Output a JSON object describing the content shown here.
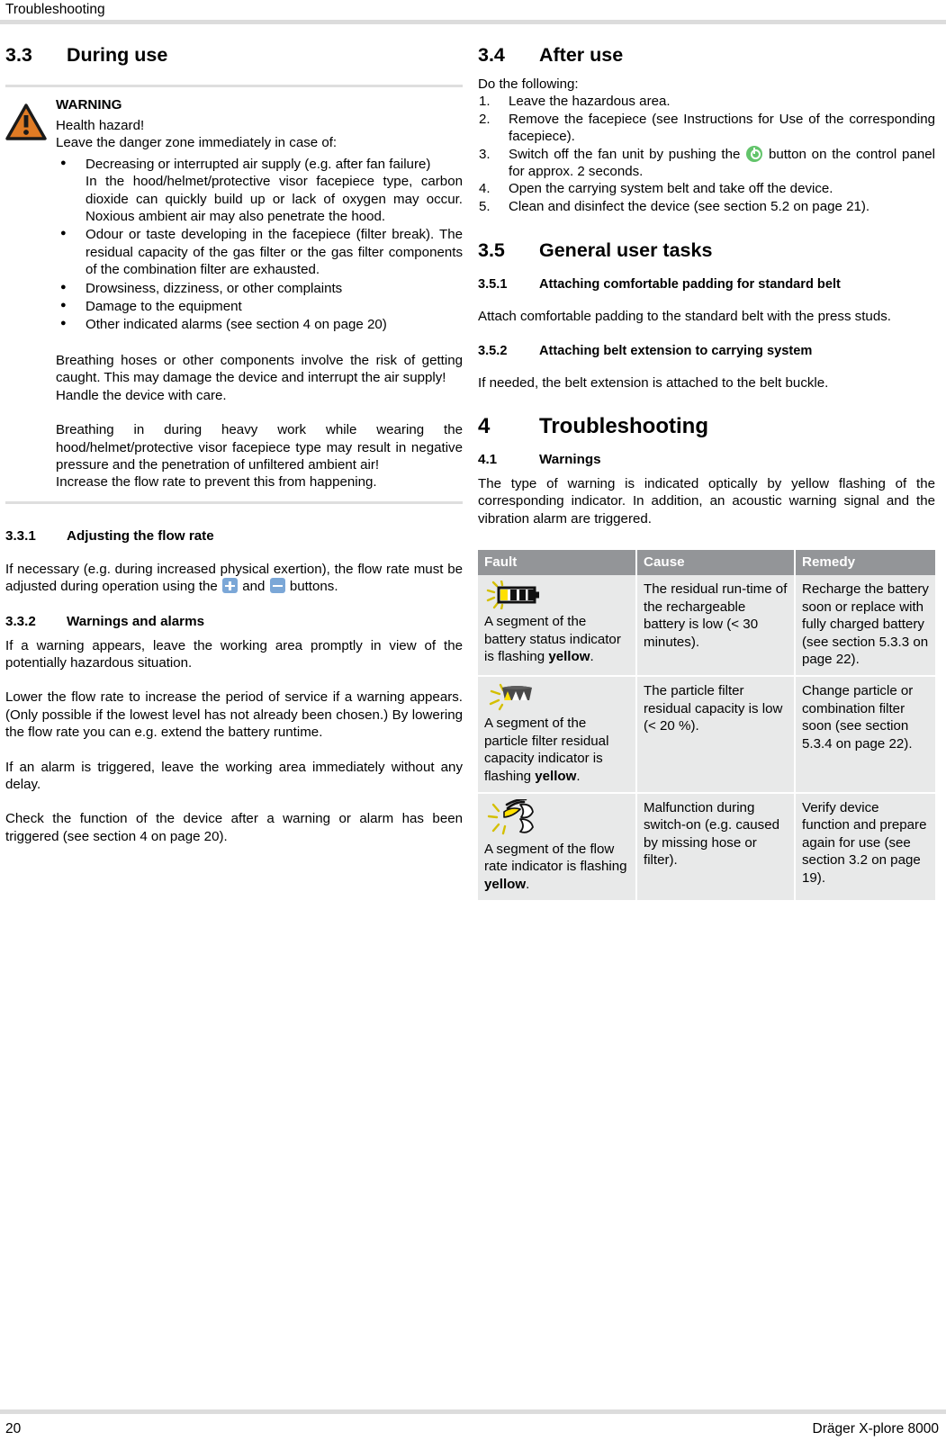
{
  "header": {
    "running_head": "Troubleshooting"
  },
  "footer": {
    "page_number": "20",
    "product": "Dräger X-plore 8000"
  },
  "colors": {
    "warning_triangle": "#e07b24",
    "table_header_bg": "#939598",
    "table_cell_bg": "#e8e9e9",
    "rule_gray": "#dcdcdc",
    "button_blue": "#7ba7d7",
    "power_green": "#63c46b",
    "flash_yellow": "#ffe000"
  },
  "left_column": {
    "section_3_3": {
      "number": "3.3",
      "title": "During use",
      "warning": {
        "label": "WARNING",
        "icon": "warning-triangle-icon",
        "lead_1": "Health hazard!",
        "lead_2": "Leave the danger zone immediately in case of:",
        "bullets": [
          {
            "text": "Decreasing or interrupted air supply (e.g. after fan failure)",
            "sub": "In the hood/helmet/protective visor facepiece type, carbon dioxide can quickly build up or lack of oxygen may occur. Noxious ambient air may also penetrate the hood."
          },
          {
            "text": "Odour or taste developing in the facepiece (filter break). The residual capacity of the gas filter or the gas filter components of the combination filter are exhausted.",
            "sub": ""
          },
          {
            "text": "Drowsiness, dizziness, or other complaints",
            "sub": ""
          },
          {
            "text": "Damage to the equipment",
            "sub": ""
          },
          {
            "text": "Other indicated alarms (see section 4 on page 20)",
            "sub": ""
          }
        ],
        "para_1": "Breathing hoses or other components involve the risk of getting caught. This may damage the device and interrupt the air supply!",
        "para_1b": "Handle the device with care.",
        "para_2": "Breathing in during heavy work while wearing the hood/helmet/protective visor facepiece type may result in negative pressure and the penetration of unfiltered ambient air!",
        "para_2b": "Increase the flow rate to prevent this from happening."
      }
    },
    "section_3_3_1": {
      "number": "3.3.1",
      "title": "Adjusting the flow rate",
      "text_before": "If necessary (e.g. during increased physical exertion), the flow rate must be adjusted during operation using the",
      "text_middle": "and",
      "text_after": "buttons.",
      "icon_plus": "plus-button-icon",
      "icon_minus": "minus-button-icon"
    },
    "section_3_3_2": {
      "number": "3.3.2",
      "title": "Warnings and alarms",
      "para_1": "If a warning appears, leave the working area promptly in view of the potentially hazardous situation.",
      "para_2": "Lower the flow rate to increase the period of service if a warning appears. (Only possible if the lowest level has not already been chosen.) By lowering the flow rate you can e.g. extend the battery runtime.",
      "para_3": "If an alarm is triggered, leave the working area immediately without any delay.",
      "para_4": "Check the function of the device after a warning or alarm has been triggered (see section 4 on page 20)."
    }
  },
  "right_column": {
    "section_3_4": {
      "number": "3.4",
      "title": "After use",
      "intro": "Do the following:",
      "steps": [
        {
          "text": "Leave the hazardous area."
        },
        {
          "text": "Remove the facepiece (see Instructions for Use of the corresponding facepiece)."
        },
        {
          "text_before": "Switch off the fan unit by pushing the",
          "icon": "power-button-icon",
          "text_after": "button on the control panel for approx. 2 seconds."
        },
        {
          "text": "Open the carrying system belt and take off the device."
        },
        {
          "text": "Clean and disinfect the device (see section 5.2 on page 21)."
        }
      ]
    },
    "section_3_5": {
      "number": "3.5",
      "title": "General user tasks",
      "sub_3_5_1": {
        "number": "3.5.1",
        "title": "Attaching comfortable padding for standard belt",
        "text": "Attach comfortable padding to the standard belt with the press studs."
      },
      "sub_3_5_2": {
        "number": "3.5.2",
        "title": "Attaching belt extension to carrying system",
        "text": "If needed, the belt extension is attached to the belt buckle."
      }
    },
    "section_4": {
      "number": "4",
      "title": "Troubleshooting",
      "sub_4_1": {
        "number": "4.1",
        "title": "Warnings",
        "text": "The type of warning is indicated optically by yellow flashing of the corresponding indicator. In addition, an acoustic warning signal and the vibration alarm are triggered."
      },
      "table": {
        "columns": [
          "Fault",
          "Cause",
          "Remedy"
        ],
        "rows": [
          {
            "icon": "battery-status-flashing-icon",
            "fault_before": "A segment of the battery status indicator is flashing ",
            "fault_bold": "yellow",
            "fault_after": ".",
            "cause": "The residual run-time of the rechargeable battery is low (< 30 minutes).",
            "remedy": "Recharge the battery soon or replace with fully charged battery (see section 5.3.3 on page 22)."
          },
          {
            "icon": "particle-filter-flashing-icon",
            "fault_before": "A segment of the particle filter residual capacity indicator is flashing ",
            "fault_bold": "yellow",
            "fault_after": ".",
            "cause": "The particle filter residual capacity is low (< 20 %).",
            "remedy": "Change particle or combination filter soon (see section 5.3.4 on page 22)."
          },
          {
            "icon": "flow-rate-flashing-icon",
            "fault_before": "A segment of the flow rate indicator is flashing ",
            "fault_bold": "yellow",
            "fault_after": ".",
            "cause": "Malfunction during switch-on (e.g. caused by missing hose or filter).",
            "remedy": "Verify device function and prepare again for use (see section 3.2 on page 19)."
          }
        ]
      }
    }
  }
}
